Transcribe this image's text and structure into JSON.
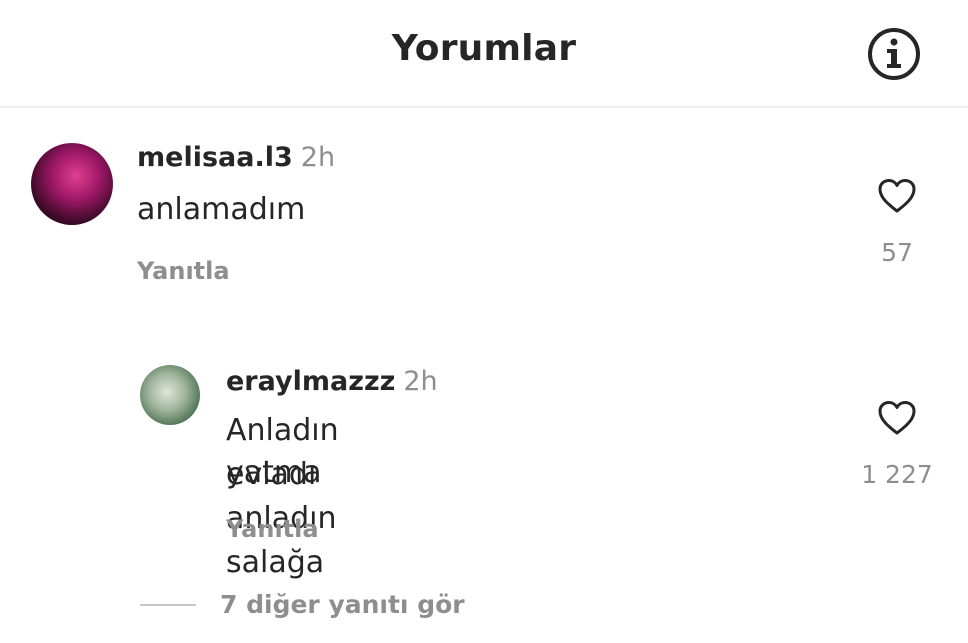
{
  "header": {
    "title": "Yorumlar",
    "info_icon": "info-circle-icon"
  },
  "comments": [
    {
      "username": "melisaa.l3",
      "time": "2h",
      "text": "anlamadım",
      "reply_label": "Yanıtla",
      "like_icon": "heart-outline-icon",
      "likes": "57"
    }
  ],
  "replies": [
    {
      "username": "eraylmazzz",
      "time": "2h",
      "text_line1": "Anladın evladı anladın salağa",
      "text_line2": "yatma",
      "reply_label": "Yanıtla",
      "like_icon": "heart-outline-icon",
      "likes": "1 227"
    }
  ],
  "more_replies_label": "7 diğer yanıtı gör",
  "colors": {
    "text": "#262626",
    "secondary": "#8e8e8e",
    "divider": "#efefef"
  }
}
